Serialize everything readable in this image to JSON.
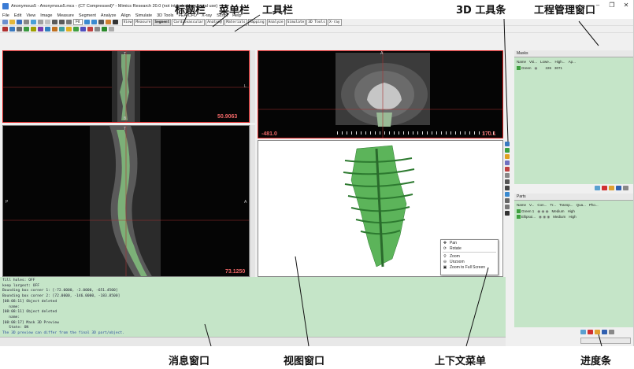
{
  "window": {
    "title": "Anonymous5 - Anonymous5.mcs - (CT Compressed)* - Mimics Research 20.0 (not intended for clinical use)",
    "minimize_icon": "minimize-icon",
    "restore_icon": "restore-icon",
    "close_icon": "close-icon"
  },
  "menu": [
    "File",
    "Edit",
    "View",
    "Image",
    "Measure",
    "Segment",
    "Analyze",
    "Align",
    "Simulate",
    "3D Tools",
    "FEA/CFD",
    "X-ray",
    "Script",
    "Help"
  ],
  "toolbar": {
    "zoom_value": "Fit",
    "tabs": [
      "View",
      "Measure",
      "Segment",
      "Cardiovascular",
      "Anatomy",
      "Materials",
      "Mapping",
      "Analyze",
      "Simulate",
      "3D Tools",
      "X-ray"
    ],
    "active_tab": "Segment"
  },
  "viewports": {
    "axial": {
      "marker_top": "T",
      "marker_bottom": "B",
      "marker_right": "L",
      "value": "50.9063"
    },
    "coronal": {
      "marker_top": "A",
      "value_left": "-481.0",
      "value_right": "170.1"
    },
    "sagittal": {
      "marker_top": "T",
      "marker_left": "P",
      "marker_right": "A",
      "value": "73.1250"
    }
  },
  "context_menu": [
    {
      "icon": "pan-icon",
      "label": "Pan"
    },
    {
      "icon": "rotate-icon",
      "label": "Rotate"
    },
    {
      "icon": "zoom-icon",
      "label": "Zoom"
    },
    {
      "icon": "unzoom-icon",
      "label": "Unzoom"
    },
    {
      "icon": "fullscreen-icon",
      "label": "Zoom to Full Screen"
    }
  ],
  "masks": {
    "header": "Masks",
    "columns": [
      "Name",
      "Vsi...",
      "Lowe...",
      "High...",
      "Ap..."
    ],
    "rows": [
      {
        "name": "Green",
        "lower": "226",
        "upper": "3071"
      }
    ]
  },
  "parts": {
    "header": "Parts",
    "columns": [
      "Name",
      "V...",
      "Con...",
      "Tr...",
      "Transp...",
      "Qua...",
      "Pho..."
    ],
    "rows": [
      {
        "name": "Green 1",
        "transparency": "Medium",
        "quality": "High"
      },
      {
        "name": "Ellipsoi...",
        "transparency": "Medium",
        "quality": "High"
      }
    ]
  },
  "log": {
    "lines": [
      "fill holes: OFF",
      "keep largest: OFF",
      "Bounding box corner 1: [-72.0000, -2.0000, -651.4500]",
      "Bounding box corner 2: [72.0000, -146.0000, -183.8500]",
      "[08:08:11] Object deleted",
      "   name:",
      "[08:08:11] Object deleted",
      "   name:",
      "[08:08:17] Mask 3D Preview",
      "   State: ON"
    ],
    "last_line": "The 3D preview can differ from the final 3D part/object."
  },
  "annotations": {
    "title_bar": "标题栏",
    "menu_bar": "菜单栏",
    "toolbar": "工具栏",
    "toolbar_3d": "3D 工具条",
    "project_window": "工程管理窗口",
    "message_window": "消息窗口",
    "view_window": "视图窗口",
    "context_menu": "上下文菜单",
    "progress_bar": "进度条"
  },
  "colors": {
    "accent_red": "#e03030",
    "panel_green": "#c5e5c8",
    "mask_green": "#3fa040"
  }
}
